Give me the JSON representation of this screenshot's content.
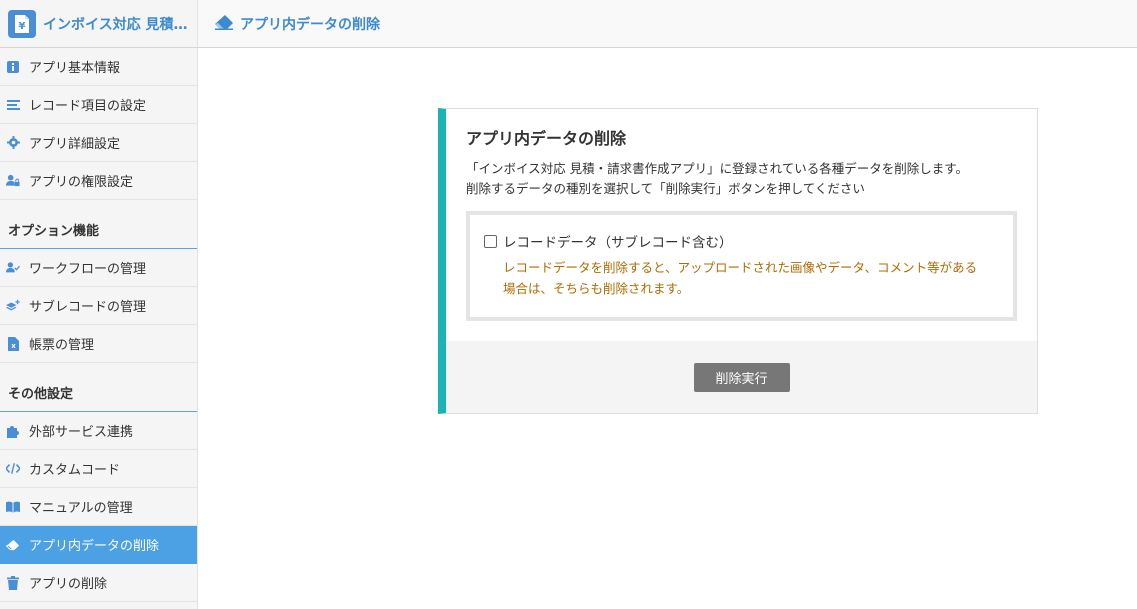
{
  "app": {
    "name": "インボイス対応 見積・請求書作成アプリ",
    "logo_glyph": "¥"
  },
  "header": {
    "title": "アプリ内データの削除",
    "icon": "eraser-icon"
  },
  "sidebar": {
    "group_main": [
      {
        "label": "アプリ基本情報",
        "icon": "info-icon"
      },
      {
        "label": "レコード項目の設定",
        "icon": "list-icon"
      },
      {
        "label": "アプリ詳細設定",
        "icon": "gear-icon"
      },
      {
        "label": "アプリの権限設定",
        "icon": "user-lock-icon"
      }
    ],
    "section_options": "オプション機能",
    "group_options": [
      {
        "label": "ワークフローの管理",
        "icon": "user-check-icon"
      },
      {
        "label": "サブレコードの管理",
        "icon": "layers-plus-icon"
      },
      {
        "label": "帳票の管理",
        "icon": "excel-file-icon"
      }
    ],
    "section_other": "その他設定",
    "group_other": [
      {
        "label": "外部サービス連携",
        "icon": "puzzle-icon"
      },
      {
        "label": "カスタムコード",
        "icon": "code-icon"
      },
      {
        "label": "マニュアルの管理",
        "icon": "book-icon"
      },
      {
        "label": "アプリ内データの削除",
        "icon": "eraser-icon",
        "active": true
      },
      {
        "label": "アプリの削除",
        "icon": "trash-icon"
      }
    ]
  },
  "card": {
    "title": "アプリ内データの削除",
    "desc_line1": "「インボイス対応 見積・請求書作成アプリ」に登録されている各種データを削除します。",
    "desc_line2": "削除するデータの種別を選択して「削除実行」ボタンを押してください",
    "option": {
      "label": "レコードデータ（サブレコード含む）",
      "checked": false,
      "note_line1": "レコードデータを削除すると、アップロードされた画像やデータ、コメント等がある",
      "note_line2": "場合は、そちらも削除されます。"
    },
    "execute_label": "削除実行"
  },
  "colors": {
    "accent": "#3e8ad0",
    "active_bg": "#4ba1e3",
    "card_border": "#1ab3b6",
    "warning_text": "#b26a00"
  }
}
